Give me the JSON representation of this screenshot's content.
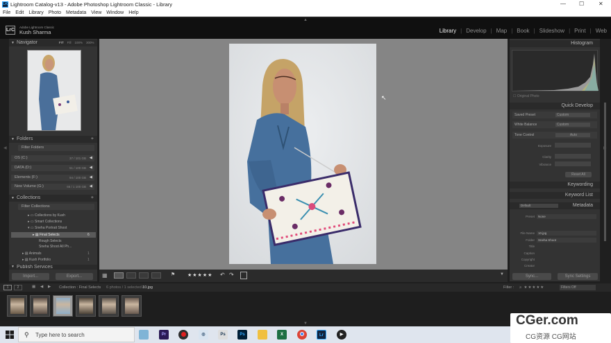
{
  "window": {
    "title": "Lightroom Catalog-v13 - Adobe Photoshop Lightroom Classic - Library",
    "logo": "LrC"
  },
  "menu": [
    "File",
    "Edit",
    "Library",
    "Photo",
    "Metadata",
    "View",
    "Window",
    "Help"
  ],
  "identity": {
    "product": "Adobe Lightroom Classic",
    "user": "Kush Sharma",
    "logo": "LrC"
  },
  "modules": [
    {
      "label": "Library",
      "active": true
    },
    {
      "label": "Develop"
    },
    {
      "label": "Map"
    },
    {
      "label": "Book"
    },
    {
      "label": "Slideshow"
    },
    {
      "label": "Print"
    },
    {
      "label": "Web"
    }
  ],
  "navigator": {
    "title": "Navigator",
    "zoom": [
      "FIT",
      "Fill",
      "100%",
      "300%"
    ]
  },
  "folders": {
    "title": "Folders",
    "filter_label": "Filter Folders",
    "items": [
      {
        "name": "OS (C:)",
        "size": "37 / 101 GB"
      },
      {
        "name": "DATA (D:)",
        "size": "51 / 100 GB"
      },
      {
        "name": "Elements (F:)",
        "size": "94 / 100 GB"
      },
      {
        "name": "New Volume (G:)",
        "size": "66 / 1 100 GB"
      }
    ]
  },
  "collections": {
    "title": "Collections",
    "filter_label": "Filter Collections",
    "items": [
      {
        "name": "Collections by Kush",
        "count": ""
      },
      {
        "name": "Smart Collections",
        "count": ""
      },
      {
        "name": "Sneha Portrait Shoot",
        "count": ""
      },
      {
        "name": "Final Selects",
        "count": "6"
      },
      {
        "name": "Rough Selects",
        "count": ""
      },
      {
        "name": "Sneha Shoot All Ph...",
        "count": ""
      },
      {
        "name": "Animals",
        "count": "1"
      },
      {
        "name": "Kush Portfolio",
        "count": "1"
      }
    ]
  },
  "publish": {
    "title": "Publish Services"
  },
  "left_buttons": {
    "import": "Import...",
    "export": "Export..."
  },
  "histogram": {
    "title": "Histogram",
    "original_photo": "Original Photo"
  },
  "quick_develop": {
    "title": "Quick Develop",
    "rows": [
      {
        "label": "Saved Preset",
        "value": "Custom"
      },
      {
        "label": "White Balance",
        "value": "Custom"
      },
      {
        "label": "Tone Control",
        "value": "Auto"
      }
    ],
    "sub_rows": [
      "Exposure",
      "Clarity",
      "Vibrance"
    ],
    "reset": "Reset All"
  },
  "keywording": {
    "title": "Keywording"
  },
  "keyword_list": {
    "title": "Keyword List"
  },
  "metadata": {
    "title": "Metadata",
    "set": "Default",
    "preset_label": "Preset",
    "preset_value": "None",
    "fields": [
      {
        "label": "File Name",
        "value": "10.jpg"
      },
      {
        "label": "Folder",
        "value": "Sneha Shoot"
      },
      {
        "label": "Title",
        "value": ""
      },
      {
        "label": "Caption",
        "value": ""
      },
      {
        "label": "Copyright",
        "value": ""
      },
      {
        "label": "Creator",
        "value": ""
      }
    ]
  },
  "right_buttons": {
    "sync": "Sync...",
    "sync_settings": "Sync Settings"
  },
  "toolbar": {
    "stars": "★★★★★"
  },
  "filmstrip_bar": {
    "page1": "1",
    "page2": "2",
    "collection": "Collection : Final Selects",
    "count": "6 photos / 1 selected /",
    "file": "10.jpg",
    "filter_label": "Filter :",
    "filter_value": "Filters Off"
  },
  "filmstrip_count": 6,
  "taskbar": {
    "search_placeholder": "Type here to search"
  },
  "watermark": {
    "line1": "CGer.com",
    "line2": "CG资源 CG网站"
  },
  "colors": {
    "accent": "#31a8ff",
    "bg": "#1f1f1f",
    "panel": "#333333",
    "canvas": "#888888"
  }
}
